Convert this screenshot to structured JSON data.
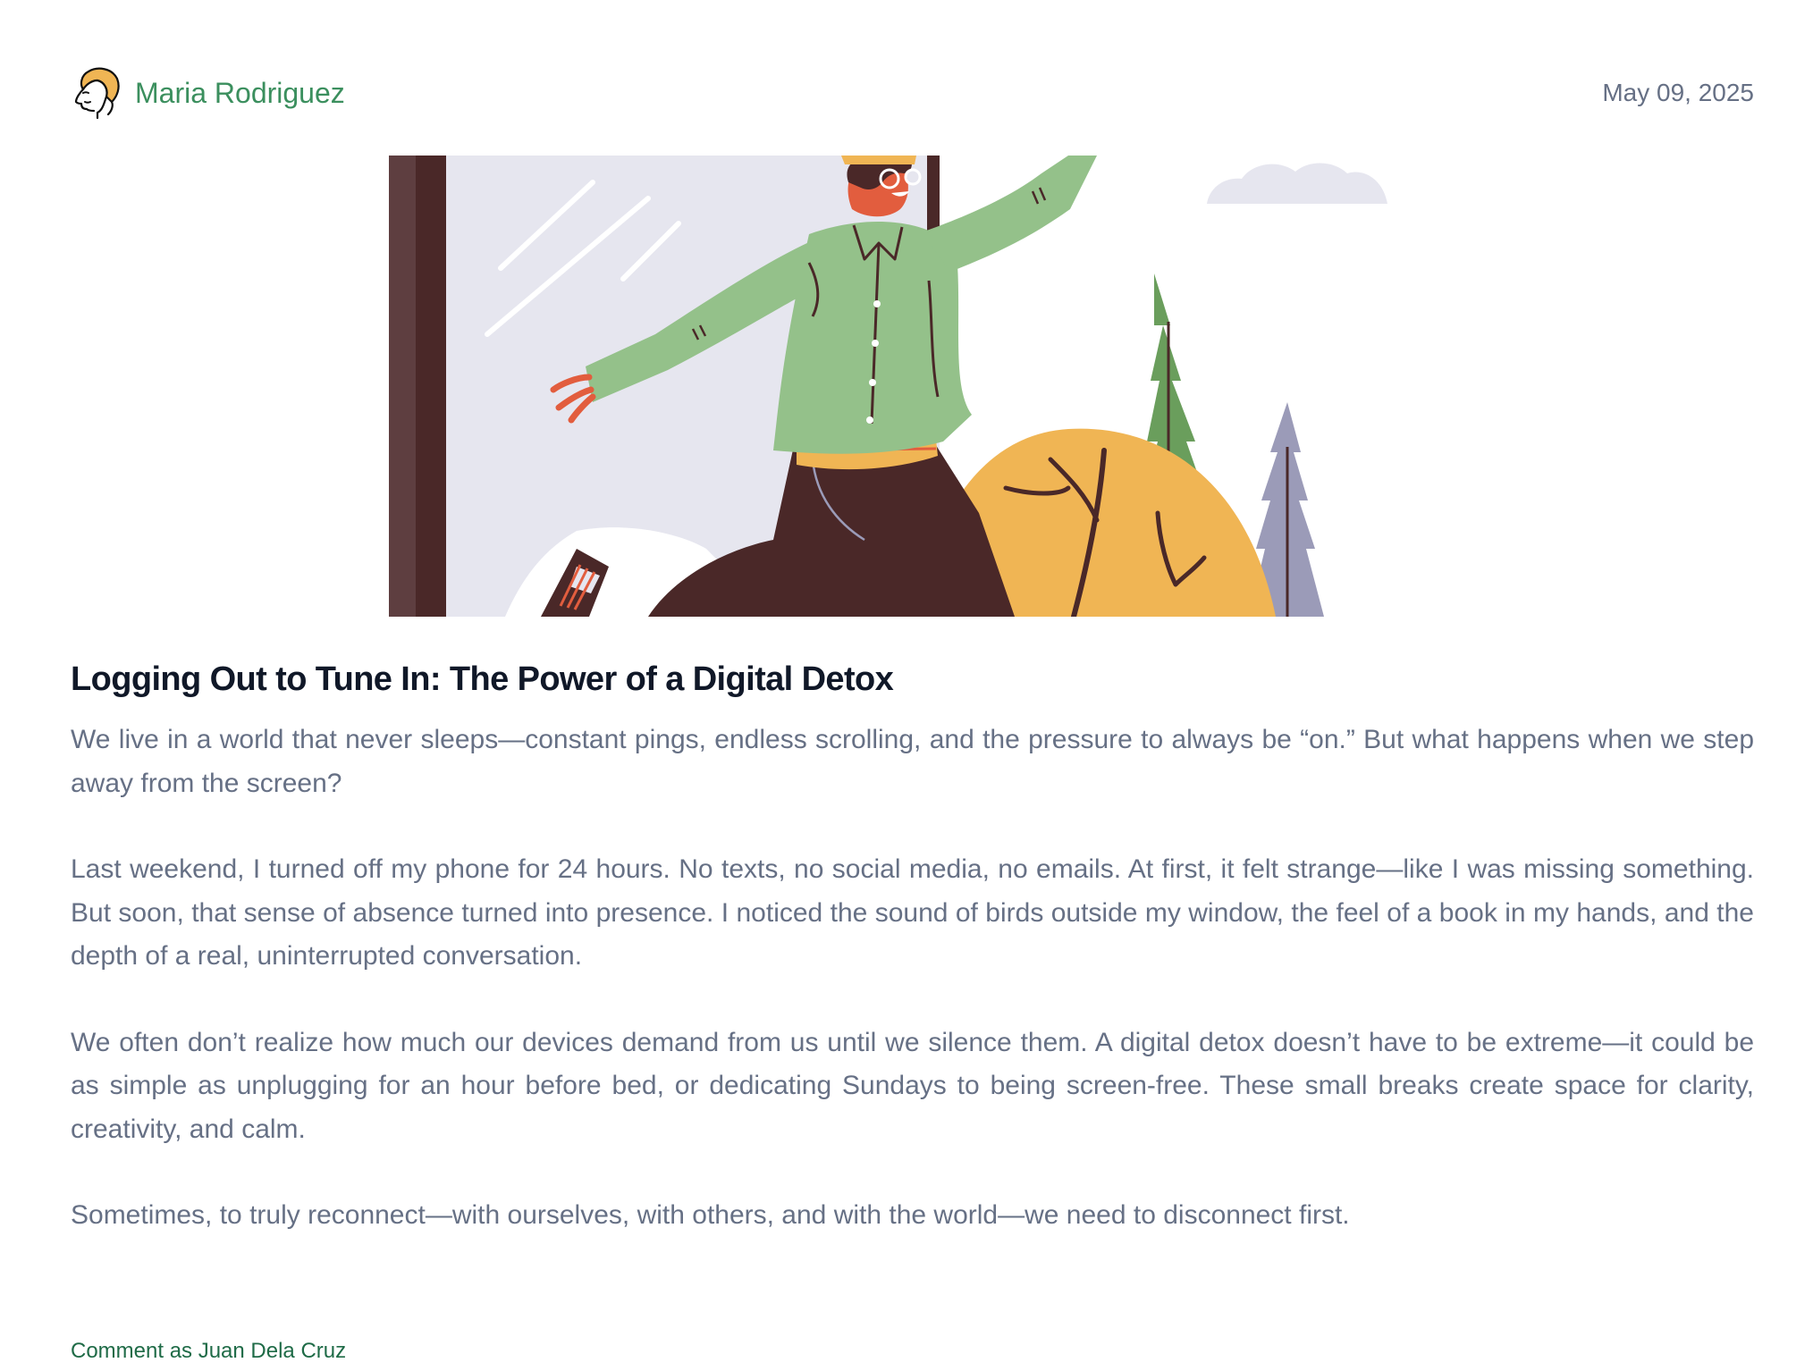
{
  "header": {
    "author_name": "Maria Rodriguez",
    "date": "May 09, 2025",
    "avatar_icon": "woman-face-avatar-icon"
  },
  "hero": {
    "illustration": "person-walking-out-door-illustration"
  },
  "article": {
    "title": "Logging Out to Tune In: The Power of a Digital Detox",
    "paragraphs": [
      "We live in a world that never sleeps—constant pings, endless scrolling, and the pressure to always be “on.” But what happens when we step away from the screen?",
      "Last weekend, I turned off my phone for 24 hours. No texts, no social media, no emails. At first, it felt strange—like I was missing something. But soon, that sense of absence turned into presence. I noticed the sound of birds outside my window, the feel of a book in my hands, and the depth of a real, uninterrupted conversation.",
      "We often don’t realize how much our devices demand from us until we silence them. A digital detox doesn’t have to be extreme—it could be as simple as unplugging for an hour before bed, or dedicating Sundays to being screen-free. These small breaks create space for clarity, creativity, and calm.",
      "Sometimes, to truly reconnect—with ourselves, with others, and with the world—we need to disconnect first."
    ]
  },
  "footer": {
    "comment_as": "Comment as Juan Dela Cruz"
  },
  "colors": {
    "author": "#3b8f5e",
    "date": "#667085",
    "title": "#101828",
    "body": "#667085",
    "comment_link": "#1f6b47",
    "jacket": "#94c18a",
    "pants": "#4a2828",
    "bush": "#f0b554",
    "window": "#e6e6ef",
    "door_frame": "#4a2828",
    "pine_green": "#6a9e5c",
    "pine_lilac": "#9b9bb8",
    "skin": "#e25d3e"
  }
}
